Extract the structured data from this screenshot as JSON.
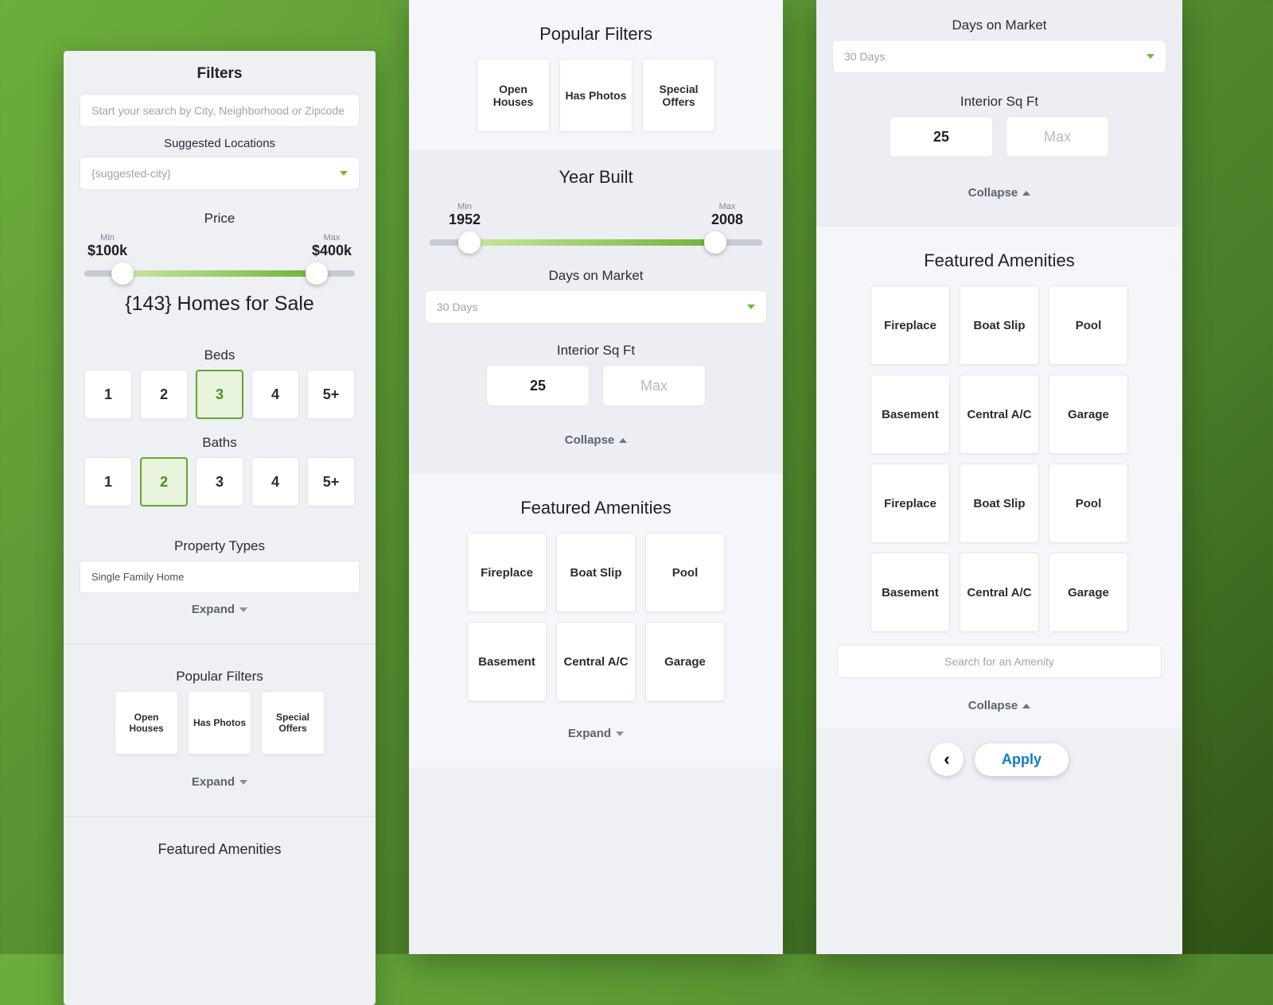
{
  "panel1": {
    "title": "Filters",
    "search_placeholder": "Start your search by City, Neighborhood or Zipcode",
    "suggested_label": "Suggested Locations",
    "suggested_value": "{suggested-city}",
    "price": {
      "label": "Price",
      "min_label": "Min",
      "min": "$100k",
      "max_label": "Max",
      "max": "$400k"
    },
    "results": "{143} Homes for Sale",
    "beds": {
      "label": "Beds",
      "options": [
        "1",
        "2",
        "3",
        "4",
        "5+"
      ],
      "selected": "3"
    },
    "baths": {
      "label": "Baths",
      "options": [
        "1",
        "2",
        "3",
        "4",
        "5+"
      ],
      "selected": "2"
    },
    "property_types": {
      "label": "Property Types",
      "value": "Single Family Home",
      "toggle": "Expand"
    },
    "popular": {
      "label": "Popular Filters",
      "tiles": [
        "Open Houses",
        "Has Photos",
        "Special Offers"
      ],
      "toggle": "Expand"
    },
    "featured_label": "Featured Amenities"
  },
  "panel2": {
    "popular": {
      "label": "Popular Filters",
      "tiles": [
        "Open Houses",
        "Has Photos",
        "Special Offers"
      ]
    },
    "year": {
      "label": "Year Built",
      "min_label": "Min",
      "min": "1952",
      "max_label": "Max",
      "max": "2008"
    },
    "dom": {
      "label": "Days on Market",
      "value": "30 Days"
    },
    "sqft": {
      "label": "Interior Sq Ft",
      "min": "25",
      "max_ph": "Max"
    },
    "collapse": "Collapse",
    "featured": {
      "label": "Featured Amenities",
      "tiles": [
        "Fireplace",
        "Boat Slip",
        "Pool",
        "Basement",
        "Central A/C",
        "Garage"
      ],
      "toggle": "Expand"
    }
  },
  "panel3": {
    "dom": {
      "label": "Days on Market",
      "value": "30 Days"
    },
    "sqft": {
      "label": "Interior Sq Ft",
      "min": "25",
      "max_ph": "Max"
    },
    "collapse": "Collapse",
    "featured": {
      "label": "Featured Amenities",
      "tiles": [
        "Fireplace",
        "Boat Slip",
        "Pool",
        "Basement",
        "Central A/C",
        "Garage",
        "Fireplace",
        "Boat Slip",
        "Pool",
        "Basement",
        "Central A/C",
        "Garage"
      ],
      "search_ph": "Search for an Amenity",
      "toggle": "Collapse"
    },
    "back": "‹",
    "apply": "Apply"
  }
}
